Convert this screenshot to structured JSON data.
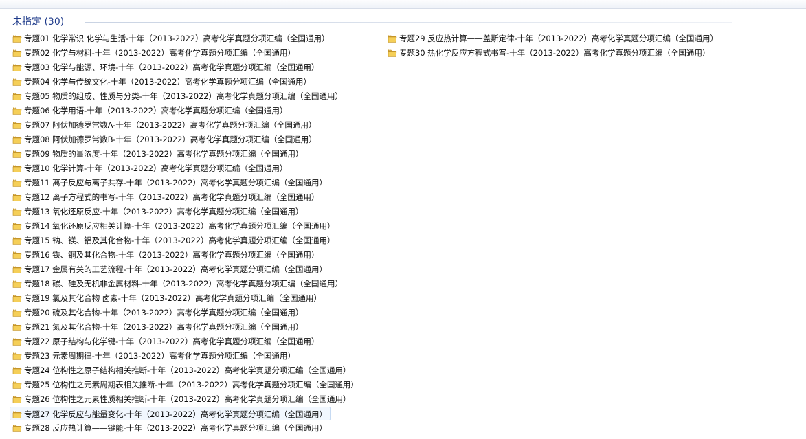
{
  "group": {
    "title": "未指定 (30)"
  },
  "icons": {
    "item_icon": "folder-icon",
    "folder_colors": {
      "back": "#c99a2e",
      "front": "#f5cf58",
      "shadow": "#b8861f"
    }
  },
  "items": [
    "专题01  化学常识  化学与生活-十年（2013-2022）高考化学真题分项汇编（全国通用）",
    "专题02  化学与材料-十年（2013-2022）高考化学真题分项汇编（全国通用）",
    "专题03  化学与能源、环境-十年（2013-2022）高考化学真题分项汇编（全国通用）",
    "专题04  化学与传统文化-十年（2013-2022）高考化学真题分项汇编（全国通用）",
    "专题05  物质的组成、性质与分类-十年（2013-2022）高考化学真题分项汇编（全国通用）",
    "专题06  化学用语-十年（2013-2022）高考化学真题分项汇编（全国通用）",
    "专题07  阿伏加德罗常数A-十年（2013-2022）高考化学真题分项汇编（全国通用）",
    "专题08  阿伏加德罗常数B-十年（2013-2022）高考化学真题分项汇编（全国通用）",
    "专题09  物质的量浓度-十年（2013-2022）高考化学真题分项汇编（全国通用）",
    "专题10  化学计算-十年（2013-2022）高考化学真题分项汇编（全国通用）",
    "专题11  离子反应与离子共存-十年（2013-2022）高考化学真题分项汇编（全国通用）",
    "专题12  离子方程式的书写-十年（2013-2022）高考化学真题分项汇编（全国通用）",
    "专题13  氧化还原反应-十年（2013-2022）高考化学真题分项汇编（全国通用）",
    "专题14  氧化还原反应相关计算-十年（2013-2022）高考化学真题分项汇编（全国通用）",
    "专题15  钠、镁、铝及其化合物-十年（2013-2022）高考化学真题分项汇编（全国通用）",
    "专题16  铁、铜及其化合物-十年（2013-2022）高考化学真题分项汇编（全国通用）",
    "专题17  金属有关的工艺流程-十年（2013-2022）高考化学真题分项汇编（全国通用）",
    "专题18  碳、硅及无机非金属材料-十年（2013-2022）高考化学真题分项汇编（全国通用）",
    "专题19  氯及其化合物  卤素-十年（2013-2022）高考化学真题分项汇编（全国通用）",
    "专题20  硫及其化合物-十年（2013-2022）高考化学真题分项汇编（全国通用）",
    "专题21  氮及其化合物-十年（2013-2022）高考化学真题分项汇编（全国通用）",
    "专题22  原子结构与化学键-十年（2013-2022）高考化学真题分项汇编（全国通用）",
    "专题23  元素周期律-十年（2013-2022）高考化学真题分项汇编（全国通用）",
    "专题24  位构性之原子结构相关推断-十年（2013-2022）高考化学真题分项汇编（全国通用）",
    "专题25  位构性之元素周期表相关推断-十年（2013-2022）高考化学真题分项汇编（全国通用）",
    "专题26  位构性之元素性质相关推断-十年（2013-2022）高考化学真题分项汇编（全国通用）",
    "专题27  化学反应与能量变化-十年（2013-2022）高考化学真题分项汇编（全国通用）",
    "专题28  反应热计算——键能-十年（2013-2022）高考化学真题分项汇编（全国通用）",
    "专题29  反应热计算——盖斯定律-十年（2013-2022）高考化学真题分项汇编（全国通用）",
    "专题30  热化学反应方程式书写-十年（2013-2022）高考化学真题分项汇编（全国通用）"
  ],
  "selected_index": 26,
  "colors": {
    "header_text": "#1e3a8a",
    "selection_fill": "#f1f7fe",
    "selection_border": "#c6daf2"
  }
}
